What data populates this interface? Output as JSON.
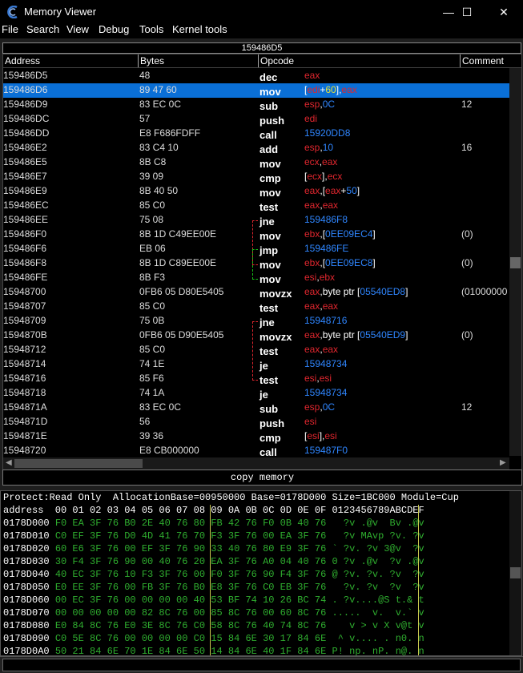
{
  "window": {
    "title": "Memory Viewer",
    "min_glyph": "—",
    "max_glyph": "☐",
    "close_glyph": "✕"
  },
  "menu": [
    "File",
    "Search",
    "View",
    "Debug",
    "Tools",
    "Kernel tools"
  ],
  "address_bar": "159486D5",
  "disasm": {
    "columns": [
      "Address",
      "Bytes",
      "Opcode",
      "Comment"
    ],
    "selected_index": 1,
    "rows": [
      {
        "addr": "159486D5",
        "bytes": "48",
        "op": "dec",
        "args": [
          [
            "eax",
            "r"
          ]
        ],
        "comment": ""
      },
      {
        "addr": "159486D6",
        "bytes": "89 47 60",
        "op": "mov",
        "args": [
          [
            "[",
            "w"
          ],
          [
            "edi",
            "r"
          ],
          [
            "+",
            "w"
          ],
          [
            "60",
            "y"
          ],
          [
            "],",
            "w"
          ],
          [
            "eax",
            "r"
          ]
        ],
        "comment": ""
      },
      {
        "addr": "159486D9",
        "bytes": "83 EC 0C",
        "op": "sub",
        "args": [
          [
            "esp",
            "r"
          ],
          [
            ",",
            "w"
          ],
          [
            "0C",
            "b"
          ]
        ],
        "comment": "12"
      },
      {
        "addr": "159486DC",
        "bytes": "57",
        "op": "push",
        "args": [
          [
            "edi",
            "r"
          ]
        ],
        "comment": ""
      },
      {
        "addr": "159486DD",
        "bytes": "E8 F686FDFF",
        "op": "call",
        "args": [
          [
            "15920DD8",
            "b"
          ]
        ],
        "comment": ""
      },
      {
        "addr": "159486E2",
        "bytes": "83 C4 10",
        "op": "add",
        "args": [
          [
            "esp",
            "r"
          ],
          [
            ",",
            "w"
          ],
          [
            "10",
            "b"
          ]
        ],
        "comment": "16"
      },
      {
        "addr": "159486E5",
        "bytes": "8B C8",
        "op": "mov",
        "args": [
          [
            "ecx",
            "r"
          ],
          [
            ",",
            "w"
          ],
          [
            "eax",
            "r"
          ]
        ],
        "comment": ""
      },
      {
        "addr": "159486E7",
        "bytes": "39 09",
        "op": "cmp",
        "args": [
          [
            "[",
            "w"
          ],
          [
            "ecx",
            "r"
          ],
          [
            "],",
            "w"
          ],
          [
            "ecx",
            "r"
          ]
        ],
        "comment": ""
      },
      {
        "addr": "159486E9",
        "bytes": "8B 40 50",
        "op": "mov",
        "args": [
          [
            "eax",
            "r"
          ],
          [
            ",[",
            "w"
          ],
          [
            "eax",
            "r"
          ],
          [
            "+",
            "w"
          ],
          [
            "50",
            "b"
          ],
          [
            "]",
            "w"
          ]
        ],
        "comment": ""
      },
      {
        "addr": "159486EC",
        "bytes": "85 C0",
        "op": "test",
        "args": [
          [
            "eax",
            "r"
          ],
          [
            ",",
            "w"
          ],
          [
            "eax",
            "r"
          ]
        ],
        "comment": ""
      },
      {
        "addr": "159486EE",
        "bytes": "75 08",
        "op": "jne",
        "args": [
          [
            "159486F8",
            "b"
          ]
        ],
        "comment": ""
      },
      {
        "addr": "159486F0",
        "bytes": "8B 1D C49EE00E",
        "op": "mov",
        "args": [
          [
            "ebx",
            "r"
          ],
          [
            ",[",
            "w"
          ],
          [
            "0EE09EC4",
            "b"
          ],
          [
            "]",
            "w"
          ]
        ],
        "comment": "(0)"
      },
      {
        "addr": "159486F6",
        "bytes": "EB 06",
        "op": "jmp",
        "args": [
          [
            "159486FE",
            "b"
          ]
        ],
        "comment": ""
      },
      {
        "addr": "159486F8",
        "bytes": "8B 1D C89EE00E",
        "op": "mov",
        "args": [
          [
            "ebx",
            "r"
          ],
          [
            ",[",
            "w"
          ],
          [
            "0EE09EC8",
            "b"
          ],
          [
            "]",
            "w"
          ]
        ],
        "comment": "(0)"
      },
      {
        "addr": "159486FE",
        "bytes": "8B F3",
        "op": "mov",
        "args": [
          [
            "esi",
            "r"
          ],
          [
            ",",
            "w"
          ],
          [
            "ebx",
            "r"
          ]
        ],
        "comment": ""
      },
      {
        "addr": "15948700",
        "bytes": "0FB6 05 D80E5405",
        "op": "movzx",
        "args": [
          [
            "eax",
            "r"
          ],
          [
            ",byte ptr [",
            "w"
          ],
          [
            "05540ED8",
            "b"
          ],
          [
            "]",
            "w"
          ]
        ],
        "comment": "(01000000"
      },
      {
        "addr": "15948707",
        "bytes": "85 C0",
        "op": "test",
        "args": [
          [
            "eax",
            "r"
          ],
          [
            ",",
            "w"
          ],
          [
            "eax",
            "r"
          ]
        ],
        "comment": ""
      },
      {
        "addr": "15948709",
        "bytes": "75 0B",
        "op": "jne",
        "args": [
          [
            "15948716",
            "b"
          ]
        ],
        "comment": ""
      },
      {
        "addr": "1594870B",
        "bytes": "0FB6 05 D90E5405",
        "op": "movzx",
        "args": [
          [
            "eax",
            "r"
          ],
          [
            ",byte ptr [",
            "w"
          ],
          [
            "05540ED9",
            "b"
          ],
          [
            "]",
            "w"
          ]
        ],
        "comment": "(0)"
      },
      {
        "addr": "15948712",
        "bytes": "85 C0",
        "op": "test",
        "args": [
          [
            "eax",
            "r"
          ],
          [
            ",",
            "w"
          ],
          [
            "eax",
            "r"
          ]
        ],
        "comment": ""
      },
      {
        "addr": "15948714",
        "bytes": "74 1E",
        "op": "je",
        "args": [
          [
            "15948734",
            "b"
          ]
        ],
        "comment": ""
      },
      {
        "addr": "15948716",
        "bytes": "85 F6",
        "op": "test",
        "args": [
          [
            "esi",
            "r"
          ],
          [
            ",",
            "w"
          ],
          [
            "esi",
            "r"
          ]
        ],
        "comment": ""
      },
      {
        "addr": "15948718",
        "bytes": "74 1A",
        "op": "je",
        "args": [
          [
            "15948734",
            "b"
          ]
        ],
        "comment": ""
      },
      {
        "addr": "1594871A",
        "bytes": "83 EC 0C",
        "op": "sub",
        "args": [
          [
            "esp",
            "r"
          ],
          [
            ",",
            "w"
          ],
          [
            "0C",
            "b"
          ]
        ],
        "comment": "12"
      },
      {
        "addr": "1594871D",
        "bytes": "56",
        "op": "push",
        "args": [
          [
            "esi",
            "r"
          ]
        ],
        "comment": ""
      },
      {
        "addr": "1594871E",
        "bytes": "39 36",
        "op": "cmp",
        "args": [
          [
            "[",
            "w"
          ],
          [
            "esi",
            "r"
          ],
          [
            "],",
            "w"
          ],
          [
            "esi",
            "r"
          ]
        ],
        "comment": ""
      },
      {
        "addr": "15948720",
        "bytes": "E8 CB000000",
        "op": "call",
        "args": [
          [
            "159487F0",
            "b"
          ]
        ],
        "comment": ""
      }
    ]
  },
  "copy_memory_label": "copy memory",
  "hex": {
    "protect_line": "Protect:Read Only  AllocationBase=00950000 Base=0178D000 Size=1BC000 Module=Cup",
    "header_line": "address  00 01 02 03 04 05 06 07 08 09 0A 0B 0C 0D 0E 0F 0123456789ABCDEF",
    "rows": [
      {
        "addr": "0178D000",
        "a": "F0 EA 3F 76 B0 2E 40 76",
        "b": "80 FB 42 76 F0 0B 40 76",
        "ascii": "  ?v .@v  Bv .@v"
      },
      {
        "addr": "0178D010",
        "a": "C0 EF 3F 76 D0 4D 41 76",
        "b": "70 F3 3F 76 00 EA 3F 76",
        "ascii": "  ?v MAvp ?v. ?v"
      },
      {
        "addr": "0178D020",
        "a": "60 E6 3F 76 00 EF 3F 76",
        "b": "90 33 40 76 80 E9 3F 76",
        "ascii": "` ?v. ?v 3@v  ?v"
      },
      {
        "addr": "0178D030",
        "a": "30 F4 3F 76 90 00 40 76",
        "b": "20 EA 3F 76 A0 04 40 76",
        "ascii": "0 ?v .@v  ?v .@v"
      },
      {
        "addr": "0178D040",
        "a": "40 EC 3F 76 10 F3 3F 76",
        "b": "00 F0 3F 76 90 F4 3F 76",
        "ascii": "@ ?v. ?v. ?v  ?v"
      },
      {
        "addr": "0178D050",
        "a": "E0 EE 3F 76 00 FB 3F 76",
        "b": "B0 E8 3F 76 C0 EB 3F 76",
        "ascii": "  ?v. ?v  ?v  ?v"
      },
      {
        "addr": "0178D060",
        "a": "00 EC 3F 76 00 00 00 00",
        "b": "40 53 BF 74 10 26 BC 74",
        "ascii": ". ?v....@S t.& t"
      },
      {
        "addr": "0178D070",
        "a": "00 00 00 00 00 82 8C 76",
        "b": "00 85 8C 76 00 60 8C 76",
        "ascii": ".....  v.  v.` v"
      },
      {
        "addr": "0178D080",
        "a": "E0 84 8C 76 E0 3E 8C 76",
        "b": "C0 58 8C 76 40 74 8C 76",
        "ascii": "   v > v X v@t v"
      },
      {
        "addr": "0178D090",
        "a": "C0 5E 8C 76 00 00 00 00",
        "b": "C0 15 84 6E 30 17 84 6E",
        "ascii": " ^ v.... . n0. n"
      },
      {
        "addr": "0178D0A0",
        "a": "50 21 84 6E 70 1E 84 6E",
        "b": "50 14 84 6E 40 1F 84 6E",
        "ascii": "P! np. nP. n@. n"
      }
    ]
  },
  "colors": {
    "reg": "#e0262e",
    "imm": "#2f86ff",
    "disp": "#e6e23a",
    "sel": "#0a6fd6",
    "hex": "#2fae2f"
  }
}
